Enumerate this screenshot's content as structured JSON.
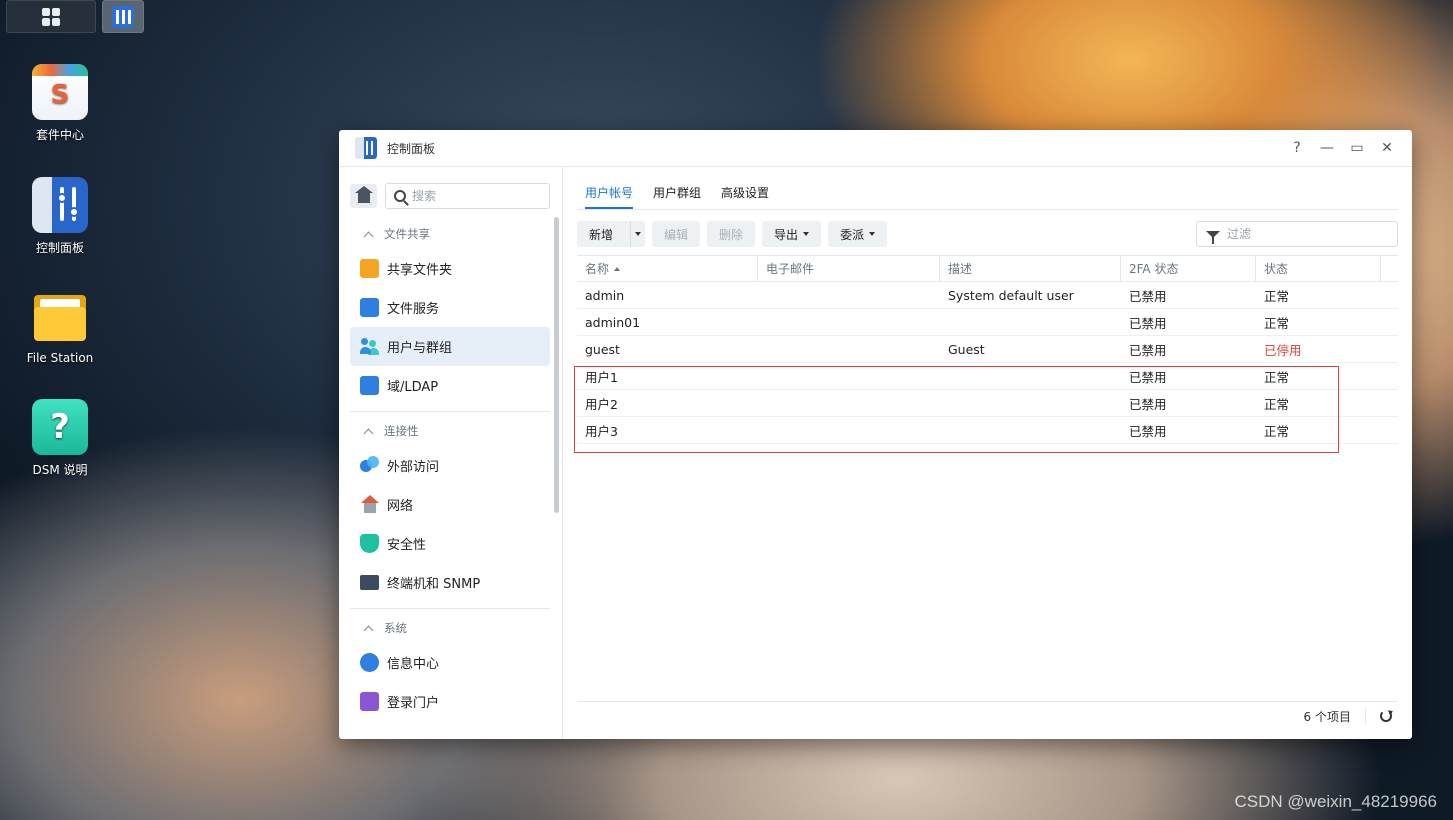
{
  "desktop": {
    "icons": [
      {
        "label": "套件中心",
        "icon": "package-center-icon"
      },
      {
        "label": "控制面板",
        "icon": "control-panel-icon"
      },
      {
        "label": "File Station",
        "icon": "folder-icon"
      },
      {
        "label": "DSM 说明",
        "icon": "help-icon"
      }
    ],
    "watermark": "CSDN @weixin_48219966"
  },
  "window": {
    "title": "控制面板",
    "controls": {
      "help": "?",
      "minimize": "—",
      "maximize": "▭",
      "close": "✕"
    }
  },
  "sidebar": {
    "search_placeholder": "搜索",
    "sections": [
      {
        "title": "文件共享",
        "items": [
          "共享文件夹",
          "文件服务",
          "用户与群组",
          "域/LDAP"
        ]
      },
      {
        "title": "连接性",
        "items": [
          "外部访问",
          "网络",
          "安全性",
          "终端机和 SNMP"
        ]
      },
      {
        "title": "系统",
        "items": [
          "信息中心",
          "登录门户"
        ]
      }
    ]
  },
  "main": {
    "tabs": [
      "用户帐号",
      "用户群组",
      "高级设置"
    ],
    "active_tab": "用户帐号",
    "toolbar": {
      "create": "新增",
      "edit": "编辑",
      "delete": "删除",
      "export": "导出",
      "delegate": "委派",
      "filter_placeholder": "过滤"
    },
    "columns": [
      "名称",
      "电子邮件",
      "描述",
      "2FA 状态",
      "状态"
    ],
    "rows": [
      {
        "name": "admin",
        "email": "",
        "description": "System default user",
        "twofa": "已禁用",
        "status": "正常"
      },
      {
        "name": "admin01",
        "email": "",
        "description": "",
        "twofa": "已禁用",
        "status": "正常"
      },
      {
        "name": "guest",
        "email": "",
        "description": "Guest",
        "twofa": "已禁用",
        "status": "已停用"
      },
      {
        "name": "用户1",
        "email": "",
        "description": "",
        "twofa": "已禁用",
        "status": "正常"
      },
      {
        "name": "用户2",
        "email": "",
        "description": "",
        "twofa": "已禁用",
        "status": "正常"
      },
      {
        "name": "用户3",
        "email": "",
        "description": "",
        "twofa": "已禁用",
        "status": "正常"
      }
    ],
    "footer": {
      "count": "6 个项目"
    }
  },
  "colors": {
    "accent": "#1a73d9",
    "disabled_status": "#e0413a",
    "highlight": "#e0413a"
  }
}
